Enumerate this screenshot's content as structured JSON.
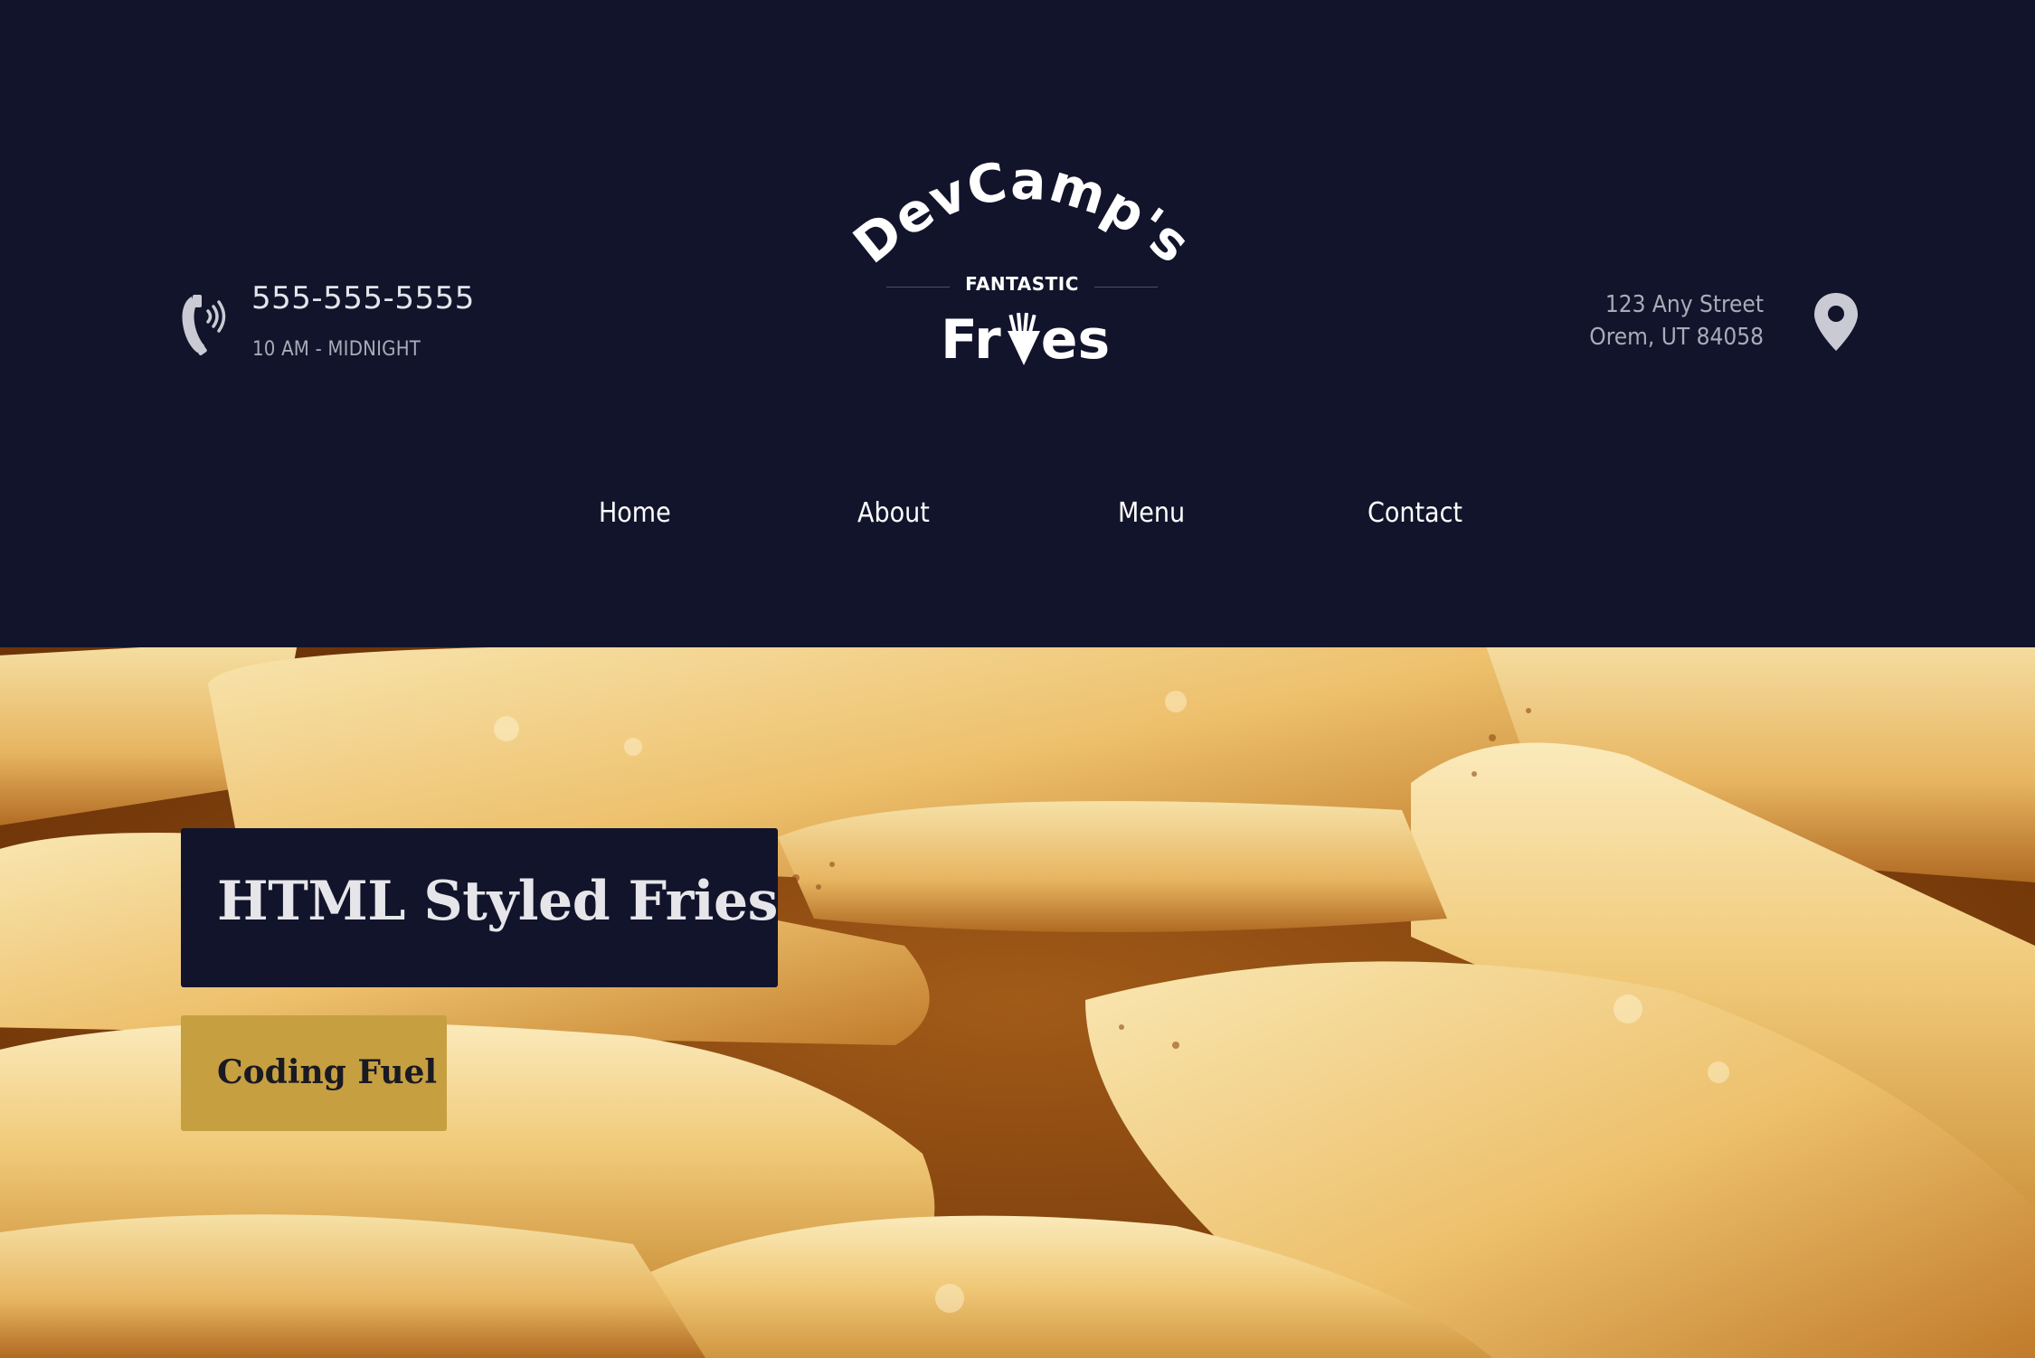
{
  "brand": {
    "logo_top": "DevCamp's",
    "logo_middle": "FANTASTIC",
    "logo_bottom_1": "Fr",
    "logo_bottom_2": "es"
  },
  "contact": {
    "phone": "555-555-5555",
    "hours": "10 AM - MIDNIGHT",
    "phone_icon": "phone-icon"
  },
  "address": {
    "line1": "123 Any Street",
    "line2": "Orem, UT 84058",
    "icon": "map-pin-icon"
  },
  "nav": {
    "items": [
      {
        "label": "Home"
      },
      {
        "label": "About"
      },
      {
        "label": "Menu"
      },
      {
        "label": "Contact"
      }
    ]
  },
  "hero": {
    "title": "HTML Styled Fries",
    "tagline": "Coding Fuel"
  },
  "colors": {
    "header_bg": "#11142b",
    "accent_gold": "#c69f41",
    "text_light": "#ffffff",
    "text_muted": "#a9abb8"
  }
}
